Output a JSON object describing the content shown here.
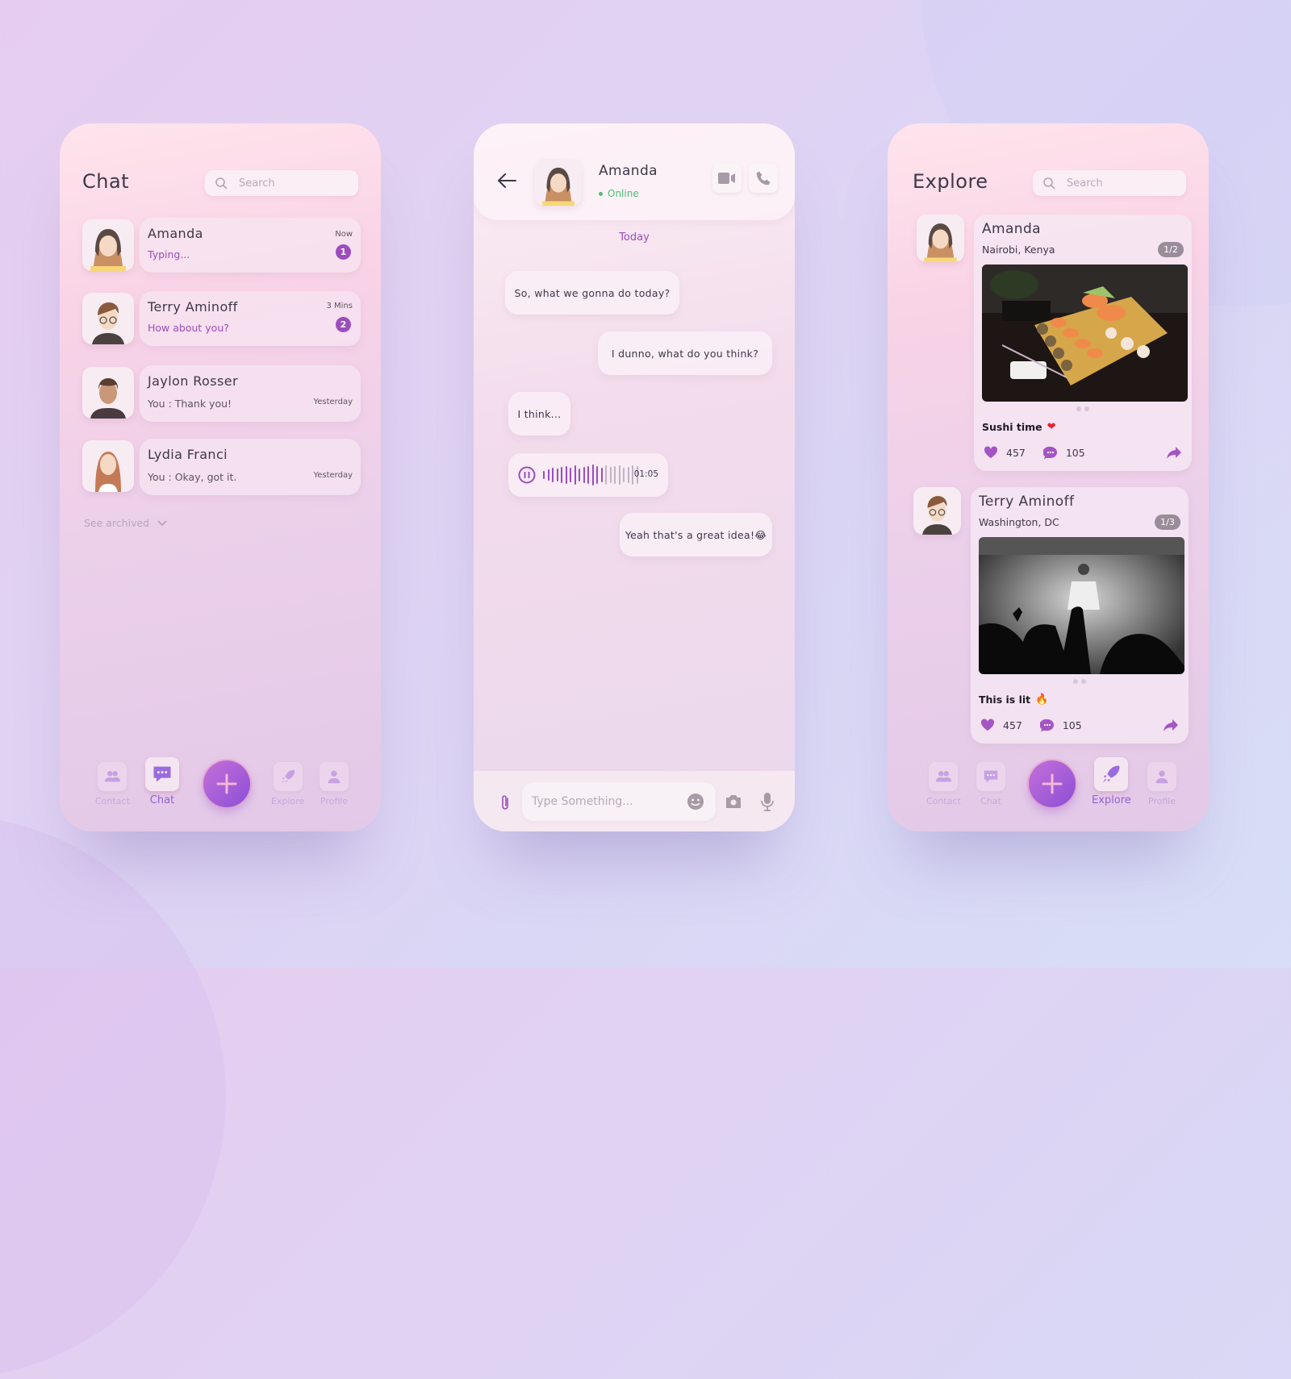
{
  "colors": {
    "accent": "#9b4dbd",
    "online": "#49c176",
    "nav_active": "#9461d4"
  },
  "chat_list": {
    "title": "Chat",
    "search_placeholder": "Search",
    "conversations": [
      {
        "name": "Amanda",
        "message": "Typing...",
        "time": "Now",
        "unread": "1",
        "highlight": true
      },
      {
        "name": "Terry Aminoff",
        "message": "How about you?",
        "time": "3 Mins",
        "unread": "2",
        "highlight": true
      },
      {
        "name": "Jaylon Rosser",
        "message": "You : Thank you!",
        "time": "Yesterday"
      },
      {
        "name": "Lydia Franci",
        "message": "You : Okay, got it.",
        "time": "Yesterday"
      }
    ],
    "see_archived": "See archived",
    "nav": {
      "contact": "Contact",
      "chat": "Chat",
      "explore": "Explore",
      "profile": "Profile",
      "active": "Chat"
    }
  },
  "conversation": {
    "contact_name": "Amanda",
    "status": "Online",
    "date_label": "Today",
    "messages": [
      {
        "from": "them",
        "text": "So, what we gonna do today?"
      },
      {
        "from": "me",
        "text": "I dunno, what do you think?"
      },
      {
        "from": "them",
        "text": "I think..."
      },
      {
        "from": "them",
        "type": "voice",
        "duration": "01:05",
        "progress": 0.6
      },
      {
        "from": "me",
        "text": "Yeah that's a great idea!😂"
      }
    ],
    "input_placeholder": "Type Something..."
  },
  "explore": {
    "title": "Explore",
    "search_placeholder": "Search",
    "posts": [
      {
        "name": "Amanda",
        "location": "Nairobi, Kenya",
        "page": "1/2",
        "caption": "Sushi time",
        "caption_emoji": "❤️",
        "likes": "457",
        "comments": "105",
        "image": "sushi platter"
      },
      {
        "name": "Terry Aminoff",
        "location": "Washington, DC",
        "page": "1/3",
        "caption": "This is lit",
        "caption_emoji": "🔥",
        "likes": "457",
        "comments": "105",
        "image": "concert crowd"
      }
    ],
    "nav": {
      "contact": "Contact",
      "chat": "Chat",
      "explore": "Explore",
      "profile": "Profile",
      "active": "Explore"
    }
  }
}
